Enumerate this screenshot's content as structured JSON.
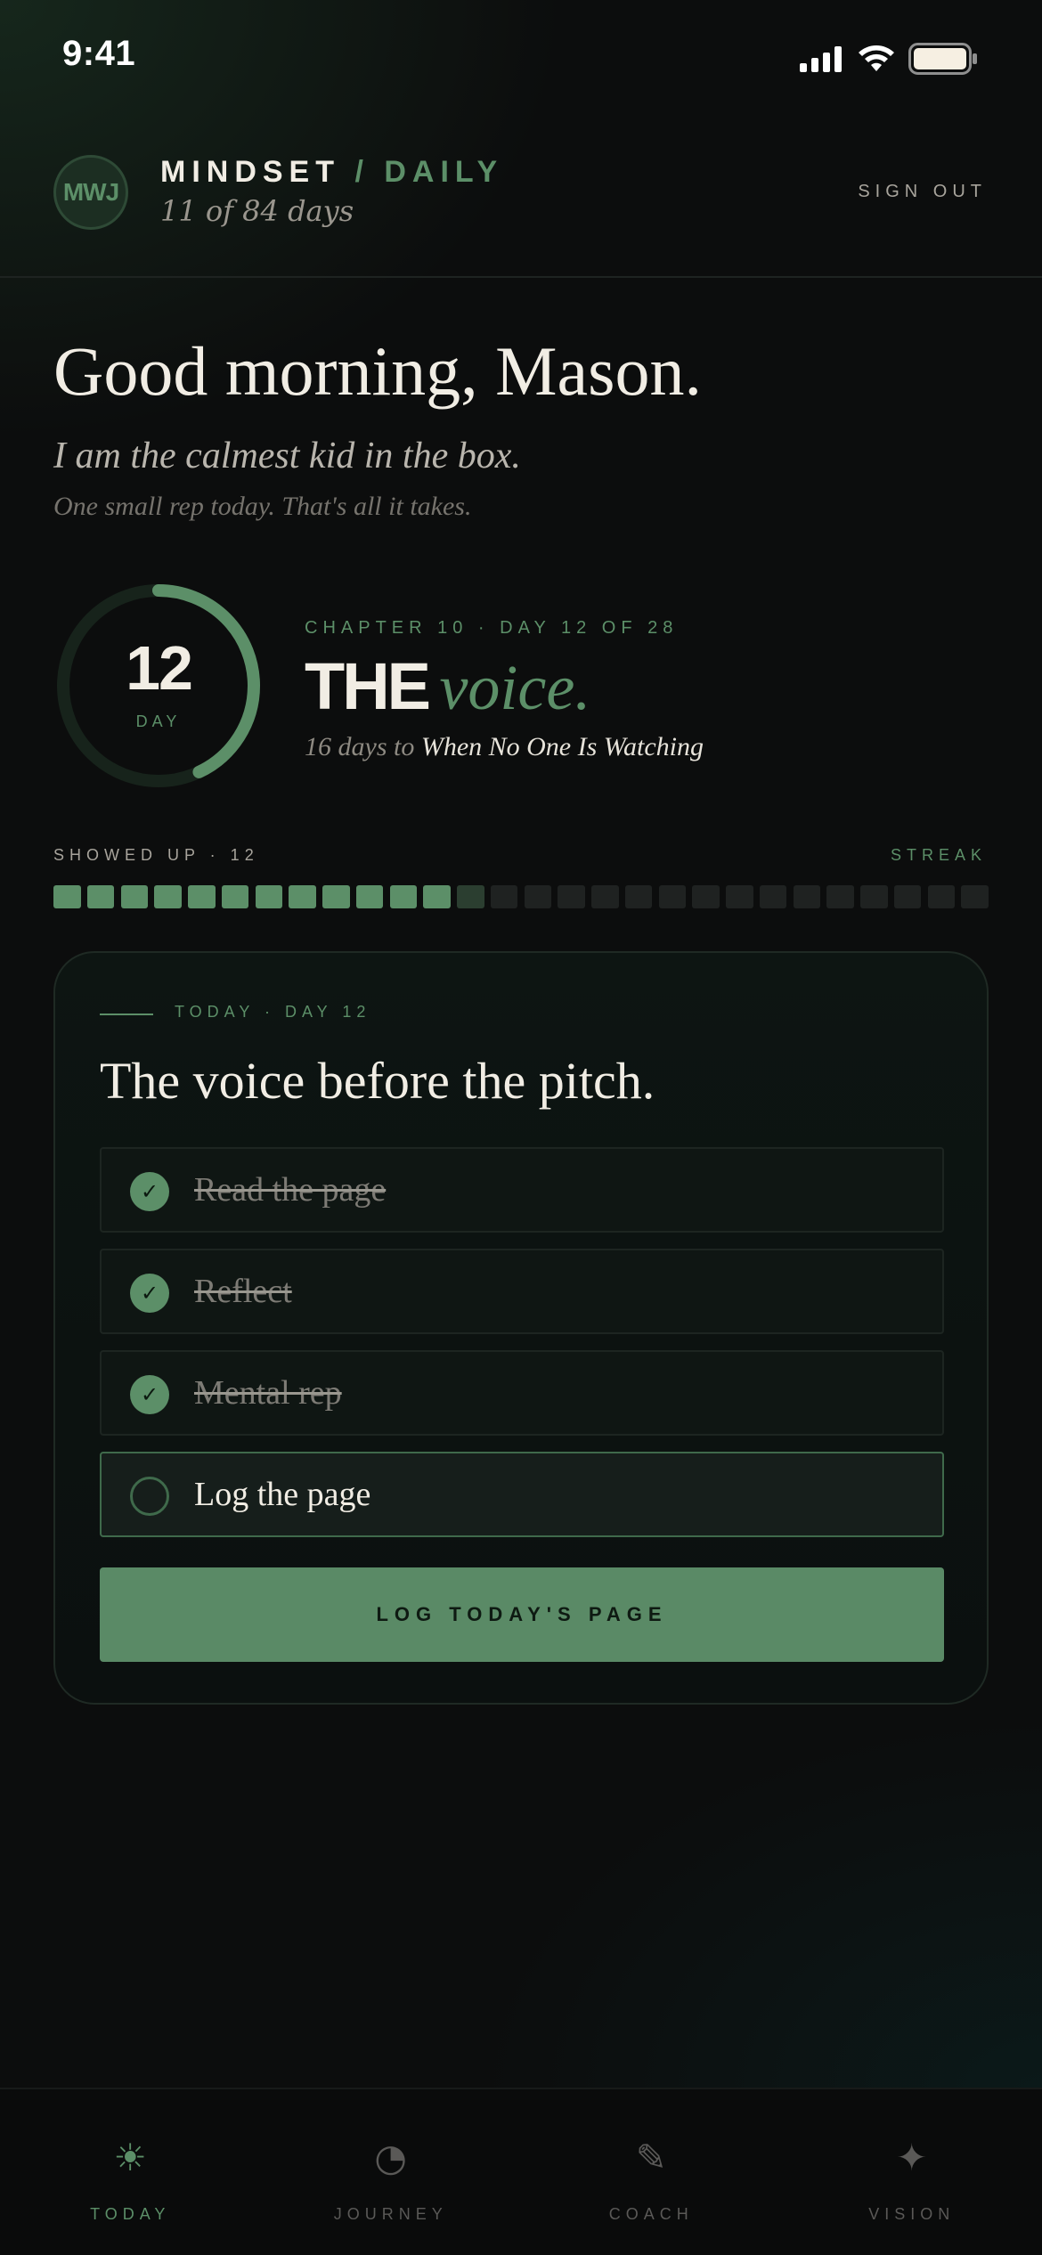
{
  "status_bar": {
    "time": "9:41",
    "icons": [
      "signal-icon",
      "wifi-icon",
      "battery-icon"
    ]
  },
  "header": {
    "avatar_initials": "MWJ",
    "brand_primary": "MINDSET",
    "brand_separator": "/",
    "brand_accent": "DAILY",
    "progress_text": "11 of 84 days",
    "sign_out_label": "SIGN OUT"
  },
  "greeting": {
    "title": "Good morning, Mason.",
    "affirmation": "I am the calmest kid in the box.",
    "tagline": "One small rep today. That's all it takes."
  },
  "day_ring": {
    "number": "12",
    "label": "DAY",
    "progress": 0.43
  },
  "chapter": {
    "meta": "CHAPTER 10 · DAY 12 OF 28",
    "title_caps": "THE",
    "title_italic": "voice.",
    "next_prefix": "16 days to",
    "next_title": "When No One Is Watching"
  },
  "streak": {
    "label": "SHOWED UP · 12",
    "right_label": "STREAK",
    "total_cells": 28,
    "completed": 12,
    "current_index": 12
  },
  "today_card": {
    "kicker": "TODAY · DAY 12",
    "title": "The voice before the pitch.",
    "tasks": [
      {
        "label": "Read the page",
        "done": true
      },
      {
        "label": "Reflect",
        "done": true
      },
      {
        "label": "Mental rep",
        "done": true
      },
      {
        "label": "Log the page",
        "done": false
      }
    ],
    "cta_label": "LOG TODAY'S PAGE"
  },
  "bottom_nav": {
    "items": [
      {
        "label": "TODAY",
        "icon": "☀",
        "icon_name": "sun-icon",
        "active": true
      },
      {
        "label": "JOURNEY",
        "icon": "◔",
        "icon_name": "pie-icon",
        "active": false
      },
      {
        "label": "COACH",
        "icon": "✎",
        "icon_name": "pencil-icon",
        "active": false
      },
      {
        "label": "VISION",
        "icon": "✦",
        "icon_name": "sparkle-icon",
        "active": false
      }
    ]
  },
  "colors": {
    "accent": "#5c8f68",
    "background": "#0c0d0d",
    "text": "#f1ede4"
  }
}
